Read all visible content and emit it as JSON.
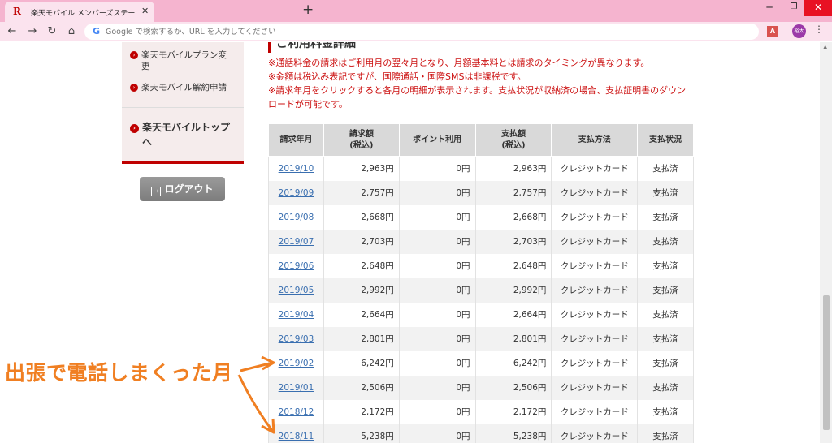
{
  "browser": {
    "tab_title": "楽天モバイル メンバーズステーション",
    "tab_favicon": "R",
    "new_tab": "+",
    "omnibox_prefix": "G",
    "omnibox_placeholder": "Google で検索するか、URL を入力してください",
    "pdf_ext": "A",
    "avatar_text": "裕太",
    "icons": [
      "back-icon",
      "forward-icon",
      "reload-icon",
      "home-icon",
      "close-icon",
      "minimize-icon",
      "maximize-icon",
      "menu-dots-icon"
    ]
  },
  "sidebar": {
    "items": [
      {
        "label": "楽天モバイルプラン変更"
      },
      {
        "label": "楽天モバイル解約申請"
      }
    ],
    "top_link": "楽天モバイルトップへ",
    "logout_label": "ログアウト"
  },
  "main": {
    "heading": "ご利用料金詳細",
    "notes": [
      "※通話料金の請求はご利用月の翌々月となり、月額基本料とは請求のタイミングが異なります。",
      "※金額は税込み表記ですが、国際通話・国際SMSは非課税です。",
      "※請求年月をクリックすると各月の明細が表示されます。支払状況が収納済の場合、支払証明書のダウンロードが可能です。"
    ],
    "table": {
      "headers": {
        "month": "請求年月",
        "billed": "請求額",
        "billed_sub": "(税込)",
        "points": "ポイント利用",
        "paid": "支払額",
        "paid_sub": "(税込)",
        "method": "支払方法",
        "status": "支払状況"
      },
      "rows": [
        {
          "month": "2019/10",
          "billed": "2,963円",
          "points": "0円",
          "paid": "2,963円",
          "method": "クレジットカード",
          "status": "支払済"
        },
        {
          "month": "2019/09",
          "billed": "2,757円",
          "points": "0円",
          "paid": "2,757円",
          "method": "クレジットカード",
          "status": "支払済"
        },
        {
          "month": "2019/08",
          "billed": "2,668円",
          "points": "0円",
          "paid": "2,668円",
          "method": "クレジットカード",
          "status": "支払済"
        },
        {
          "month": "2019/07",
          "billed": "2,703円",
          "points": "0円",
          "paid": "2,703円",
          "method": "クレジットカード",
          "status": "支払済"
        },
        {
          "month": "2019/06",
          "billed": "2,648円",
          "points": "0円",
          "paid": "2,648円",
          "method": "クレジットカード",
          "status": "支払済"
        },
        {
          "month": "2019/05",
          "billed": "2,992円",
          "points": "0円",
          "paid": "2,992円",
          "method": "クレジットカード",
          "status": "支払済"
        },
        {
          "month": "2019/04",
          "billed": "2,664円",
          "points": "0円",
          "paid": "2,664円",
          "method": "クレジットカード",
          "status": "支払済"
        },
        {
          "month": "2019/03",
          "billed": "2,801円",
          "points": "0円",
          "paid": "2,801円",
          "method": "クレジットカード",
          "status": "支払済"
        },
        {
          "month": "2019/02",
          "billed": "6,242円",
          "points": "0円",
          "paid": "6,242円",
          "method": "クレジットカード",
          "status": "支払済"
        },
        {
          "month": "2019/01",
          "billed": "2,506円",
          "points": "0円",
          "paid": "2,506円",
          "method": "クレジットカード",
          "status": "支払済"
        },
        {
          "month": "2018/12",
          "billed": "2,172円",
          "points": "0円",
          "paid": "2,172円",
          "method": "クレジットカード",
          "status": "支払済"
        },
        {
          "month": "2018/11",
          "billed": "5,238円",
          "points": "0円",
          "paid": "5,238円",
          "method": "クレジットカード",
          "status": "支払済"
        }
      ]
    }
  },
  "annotation": {
    "text": "出張で電話しまくった月",
    "color": "#f07f22"
  },
  "colors": {
    "brand_red": "#bf0000",
    "tab_pink": "#f5b4cf",
    "link_blue": "#3a6fb0"
  }
}
